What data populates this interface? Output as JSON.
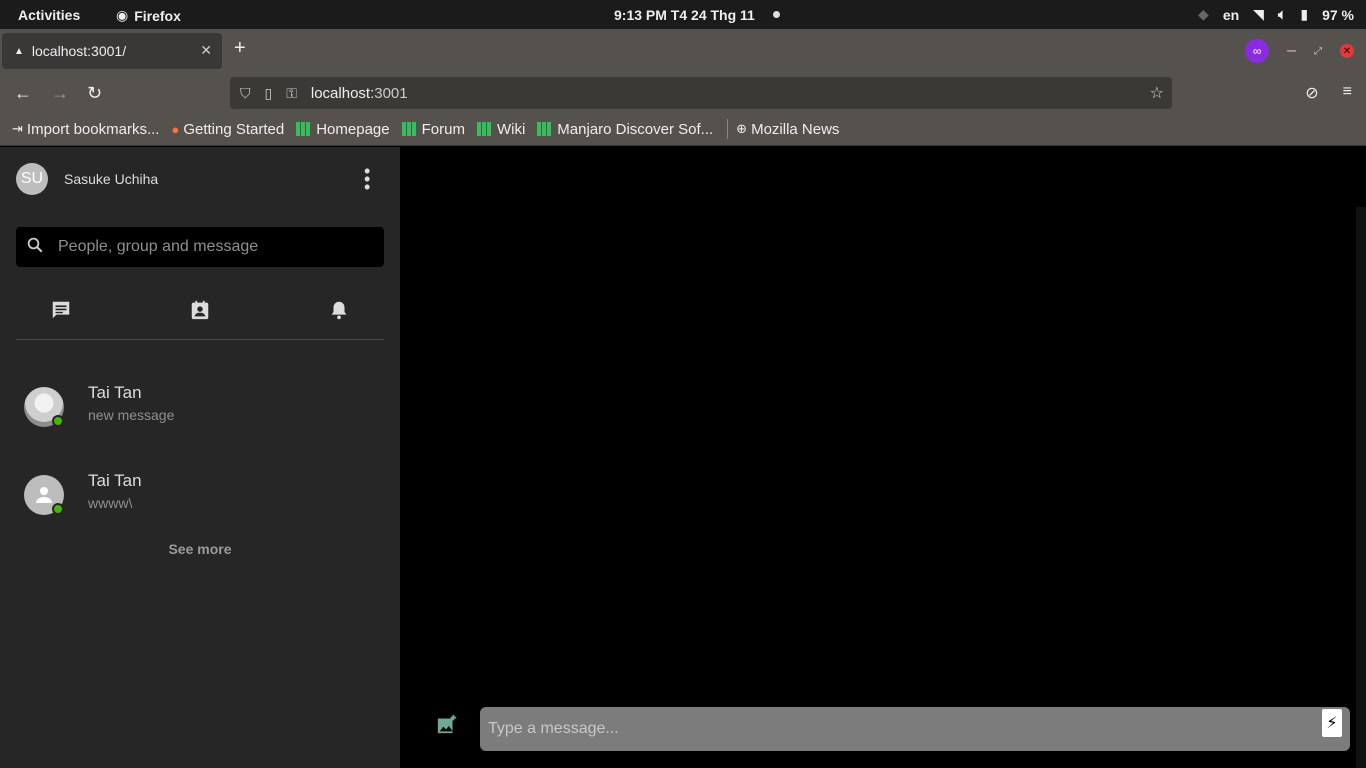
{
  "os": {
    "activities": "Activities",
    "app_name": "Firefox",
    "clock": "9:13 PM  T4 24 Thg 11",
    "language": "en",
    "battery": "97 %"
  },
  "browser": {
    "tab_title": "localhost:3001/",
    "url_host": "localhost:",
    "url_port": "3001",
    "bookmarks": [
      {
        "label": "Import bookmarks...",
        "icon": "import-icon"
      },
      {
        "label": "Getting Started",
        "icon": "firefox-icon"
      },
      {
        "label": "Homepage",
        "icon": "manjaro-icon"
      },
      {
        "label": "Forum",
        "icon": "manjaro-icon"
      },
      {
        "label": "Wiki",
        "icon": "manjaro-icon"
      },
      {
        "label": "Manjaro Discover Sof...",
        "icon": "manjaro-icon"
      },
      {
        "label": "Mozilla News",
        "icon": "globe-icon"
      }
    ]
  },
  "sidebar": {
    "user_initials": "SU",
    "user_name": "Sasuke Uchiha",
    "search_placeholder": "People, group and message",
    "conversations": [
      {
        "name": "Tai Tan",
        "last_message": "new message",
        "online": true,
        "avatar": "photo"
      },
      {
        "name": "Tai Tan",
        "last_message": "wwww\\",
        "online": true,
        "avatar": "default"
      }
    ],
    "see_more": "See more"
  },
  "chat": {
    "message_placeholder": "Type a message..."
  },
  "colors": {
    "sidebar_bg": "#262626",
    "online": "#44b700",
    "browser_chrome": "#55524e"
  }
}
